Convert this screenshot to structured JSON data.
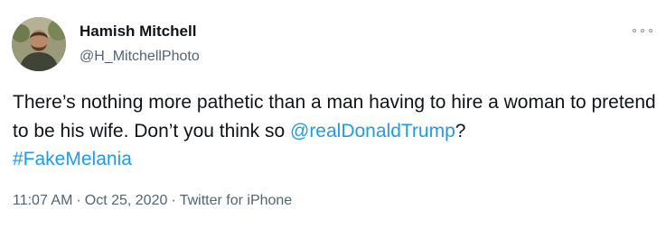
{
  "author": {
    "display_name": "Hamish Mitchell",
    "handle": "@H_MitchellPhoto",
    "avatar_icon": "profile-photo"
  },
  "more_icon": "more-options-icon",
  "tweet": {
    "text_part1": "There’s nothing more pathetic than a man having to hire a woman to pretend to be his wife. Don’t you think so ",
    "mention": "@realDonaldTrump",
    "text_part2": "?",
    "hashtag": "#FakeMelania"
  },
  "meta": {
    "time": "11:07 AM",
    "separator": "·",
    "date": "Oct 25, 2020",
    "source": "Twitter for iPhone"
  },
  "colors": {
    "link": "#1d9bf0",
    "secondary_text": "#536471",
    "primary_text": "#0f1419"
  }
}
